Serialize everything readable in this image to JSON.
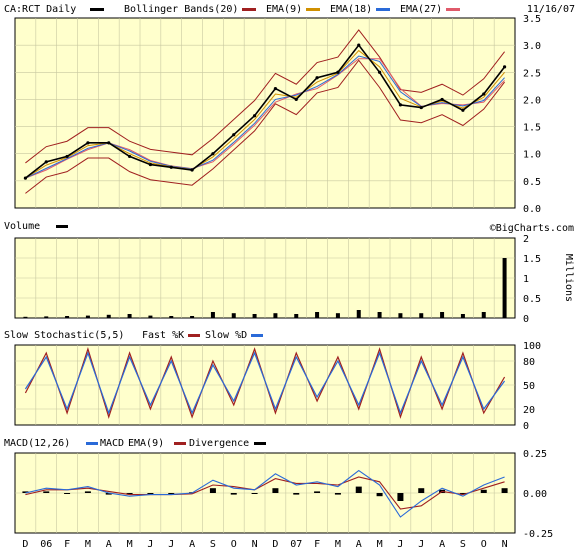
{
  "header": {
    "ticker_label": "CA:RCT Daily",
    "indicators": [
      {
        "label": "Bollinger Bands(20)",
        "color": "#a02020"
      },
      {
        "label": "EMA(9)",
        "color": "#d09000"
      },
      {
        "label": "EMA(18)",
        "color": "#2a6ad8"
      },
      {
        "label": "EMA(27)",
        "color": "#e05a6a"
      }
    ],
    "date": "11/16/07",
    "watermark": "©BigCharts.com"
  },
  "colors": {
    "panel_bg": "#ffffcc",
    "grid": "#c8c8a0",
    "price": "#000000",
    "bollinger": "#a02020",
    "ema9": "#d09000",
    "ema18": "#2a6ad8",
    "ema27": "#e05a6a",
    "fast_k": "#a02020",
    "slow_d": "#2a6ad8",
    "macd": "#2a6ad8",
    "macd_ema": "#a02020",
    "divergence": "#000000"
  },
  "panels": {
    "volume": {
      "label": "Volume",
      "unit_label": "Millions"
    },
    "stochastic": {
      "label": "Slow Stochastic(5,5)",
      "k_label": "Fast %K",
      "d_label": "Slow %D"
    },
    "macd": {
      "label": "MACD(12,26)",
      "macd_label": "MACD",
      "ema_label": "EMA(9)",
      "div_label": "Divergence"
    }
  },
  "x_axis_labels": [
    "D",
    "06",
    "F",
    "M",
    "A",
    "M",
    "J",
    "J",
    "A",
    "S",
    "O",
    "N",
    "D",
    "07",
    "F",
    "M",
    "A",
    "M",
    "J",
    "J",
    "A",
    "S",
    "O",
    "N"
  ],
  "chart_data": [
    {
      "type": "line",
      "title": "CA:RCT Daily",
      "ylim": [
        0.0,
        3.5
      ],
      "yticks": [
        "0.0",
        "0.5",
        "1.0",
        "1.5",
        "2.0",
        "2.5",
        "3.0",
        "3.5"
      ],
      "grid": true,
      "x": [
        "Dec 05",
        "Jan 06",
        "Feb 06",
        "Mar 06",
        "Apr 06",
        "May 06",
        "Jun 06",
        "Jul 06",
        "Aug 06",
        "Sep 06",
        "Oct 06",
        "Nov 06",
        "Dec 06",
        "Jan 07",
        "Feb 07",
        "Mar 07",
        "Apr 07",
        "May 07",
        "Jun 07",
        "Jul 07",
        "Aug 07",
        "Sep 07",
        "Oct 07",
        "Nov 07"
      ],
      "series": [
        {
          "name": "CA:RCT Daily",
          "values": [
            0.55,
            0.85,
            0.95,
            1.2,
            1.2,
            0.95,
            0.8,
            0.75,
            0.7,
            1.0,
            1.35,
            1.7,
            2.2,
            2.0,
            2.4,
            2.5,
            3.0,
            2.5,
            1.9,
            1.85,
            2.0,
            1.8,
            2.1,
            2.6
          ]
        }
      ]
    },
    {
      "type": "bar",
      "title": "Volume",
      "ylabel": "Millions",
      "ylim": [
        0,
        2
      ],
      "yticks": [
        "0",
        "0.5",
        "1",
        "1.5",
        "2"
      ],
      "x": [
        "Dec 05",
        "Jan 06",
        "Feb 06",
        "Mar 06",
        "Apr 06",
        "May 06",
        "Jun 06",
        "Jul 06",
        "Aug 06",
        "Sep 06",
        "Oct 06",
        "Nov 06",
        "Dec 06",
        "Jan 07",
        "Feb 07",
        "Mar 07",
        "Apr 07",
        "May 07",
        "Jun 07",
        "Jul 07",
        "Aug 07",
        "Sep 07",
        "Oct 07",
        "Nov 07"
      ],
      "values": [
        0.03,
        0.04,
        0.05,
        0.06,
        0.08,
        0.1,
        0.06,
        0.05,
        0.05,
        0.15,
        0.12,
        0.1,
        0.12,
        0.1,
        0.15,
        0.12,
        0.2,
        0.15,
        0.12,
        0.12,
        0.15,
        0.1,
        0.15,
        1.5
      ]
    },
    {
      "type": "line",
      "title": "Slow Stochastic(5,5)",
      "ylim": [
        0,
        100
      ],
      "yticks": [
        "0",
        "20",
        "50",
        "80",
        "100"
      ],
      "x": [
        "Dec 05",
        "Jan 06",
        "Feb 06",
        "Mar 06",
        "Apr 06",
        "May 06",
        "Jun 06",
        "Jul 06",
        "Aug 06",
        "Sep 06",
        "Oct 06",
        "Nov 06",
        "Dec 06",
        "Jan 07",
        "Feb 07",
        "Mar 07",
        "Apr 07",
        "May 07",
        "Jun 07",
        "Jul 07",
        "Aug 07",
        "Sep 07",
        "Oct 07",
        "Nov 07"
      ],
      "series": [
        {
          "name": "Fast %K",
          "values": [
            40,
            90,
            15,
            95,
            10,
            90,
            20,
            85,
            10,
            80,
            25,
            95,
            15,
            90,
            30,
            85,
            20,
            95,
            10,
            85,
            20,
            90,
            15,
            60
          ]
        },
        {
          "name": "Slow %D",
          "values": [
            45,
            85,
            20,
            90,
            15,
            85,
            25,
            80,
            15,
            75,
            30,
            90,
            20,
            85,
            35,
            80,
            25,
            90,
            15,
            80,
            25,
            85,
            20,
            55
          ]
        }
      ]
    },
    {
      "type": "line",
      "title": "MACD(12,26)",
      "ylim": [
        -0.25,
        0.25
      ],
      "yticks": [
        "-0.25",
        "0.00",
        "0.25"
      ],
      "x": [
        "Dec 05",
        "Jan 06",
        "Feb 06",
        "Mar 06",
        "Apr 06",
        "May 06",
        "Jun 06",
        "Jul 06",
        "Aug 06",
        "Sep 06",
        "Oct 06",
        "Nov 06",
        "Dec 06",
        "Jan 07",
        "Feb 07",
        "Mar 07",
        "Apr 07",
        "May 07",
        "Jun 07",
        "Jul 07",
        "Aug 07",
        "Sep 07",
        "Oct 07",
        "Nov 07"
      ],
      "series": [
        {
          "name": "MACD",
          "values": [
            0.0,
            0.03,
            0.02,
            0.04,
            0.0,
            -0.02,
            -0.01,
            -0.01,
            0.0,
            0.08,
            0.03,
            0.02,
            0.12,
            0.05,
            0.07,
            0.04,
            0.14,
            0.05,
            -0.15,
            -0.05,
            0.03,
            -0.02,
            0.05,
            0.1
          ]
        },
        {
          "name": "EMA(9)",
          "values": [
            -0.01,
            0.02,
            0.02,
            0.03,
            0.01,
            -0.01,
            -0.01,
            -0.01,
            -0.005,
            0.05,
            0.04,
            0.02,
            0.09,
            0.06,
            0.06,
            0.05,
            0.1,
            0.07,
            -0.1,
            -0.08,
            0.01,
            -0.01,
            0.03,
            0.07
          ]
        },
        {
          "name": "Divergence",
          "values": [
            0.01,
            0.01,
            0.0,
            0.01,
            -0.01,
            -0.01,
            0.0,
            0.0,
            0.005,
            0.03,
            -0.01,
            0.0,
            0.03,
            -0.01,
            0.01,
            -0.01,
            0.04,
            -0.02,
            -0.05,
            0.03,
            0.02,
            -0.01,
            0.02,
            0.03
          ]
        }
      ]
    }
  ]
}
